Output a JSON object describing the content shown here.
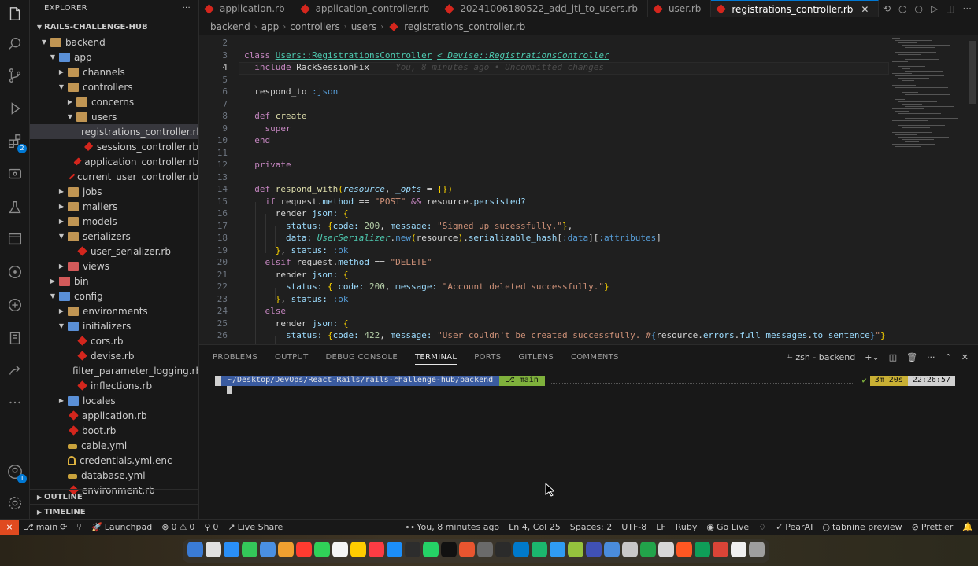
{
  "explorer": {
    "title": "EXPLORER",
    "more": "···",
    "root": "RAILS-CHALLENGE-HUB",
    "tree": [
      {
        "label": "backend",
        "depth": 0,
        "kind": "folder",
        "open": true
      },
      {
        "label": "app",
        "depth": 1,
        "kind": "folder-blue",
        "open": true
      },
      {
        "label": "channels",
        "depth": 2,
        "kind": "folder",
        "open": false
      },
      {
        "label": "controllers",
        "depth": 2,
        "kind": "folder",
        "open": true
      },
      {
        "label": "concerns",
        "depth": 3,
        "kind": "folder",
        "open": false
      },
      {
        "label": "users",
        "depth": 3,
        "kind": "folder",
        "open": true
      },
      {
        "label": "registrations_controller.rb",
        "depth": 4,
        "kind": "ruby",
        "selected": true
      },
      {
        "label": "sessions_controller.rb",
        "depth": 4,
        "kind": "ruby"
      },
      {
        "label": "application_controller.rb",
        "depth": 3,
        "kind": "ruby"
      },
      {
        "label": "current_user_controller.rb",
        "depth": 3,
        "kind": "ruby"
      },
      {
        "label": "jobs",
        "depth": 2,
        "kind": "folder",
        "open": false
      },
      {
        "label": "mailers",
        "depth": 2,
        "kind": "folder",
        "open": false
      },
      {
        "label": "models",
        "depth": 2,
        "kind": "folder",
        "open": false
      },
      {
        "label": "serializers",
        "depth": 2,
        "kind": "folder",
        "open": true
      },
      {
        "label": "user_serializer.rb",
        "depth": 3,
        "kind": "ruby"
      },
      {
        "label": "views",
        "depth": 2,
        "kind": "folder-red",
        "open": false
      },
      {
        "label": "bin",
        "depth": 1,
        "kind": "folder-red",
        "open": false
      },
      {
        "label": "config",
        "depth": 1,
        "kind": "folder-blue",
        "open": true
      },
      {
        "label": "environments",
        "depth": 2,
        "kind": "folder",
        "open": false
      },
      {
        "label": "initializers",
        "depth": 2,
        "kind": "folder-blue",
        "open": true
      },
      {
        "label": "cors.rb",
        "depth": 3,
        "kind": "ruby"
      },
      {
        "label": "devise.rb",
        "depth": 3,
        "kind": "ruby"
      },
      {
        "label": "filter_parameter_logging.rb",
        "depth": 3,
        "kind": "ruby"
      },
      {
        "label": "inflections.rb",
        "depth": 3,
        "kind": "ruby"
      },
      {
        "label": "locales",
        "depth": 2,
        "kind": "folder-blue",
        "open": false
      },
      {
        "label": "application.rb",
        "depth": 2,
        "kind": "ruby"
      },
      {
        "label": "boot.rb",
        "depth": 2,
        "kind": "ruby"
      },
      {
        "label": "cable.yml",
        "depth": 2,
        "kind": "yml"
      },
      {
        "label": "credentials.yml.enc",
        "depth": 2,
        "kind": "key"
      },
      {
        "label": "database.yml",
        "depth": 2,
        "kind": "yml"
      },
      {
        "label": "environment.rb",
        "depth": 2,
        "kind": "ruby"
      }
    ],
    "outline": "OUTLINE",
    "timeline": "TIMELINE"
  },
  "activity": {
    "extensions_badge": "2",
    "accounts_badge": "1"
  },
  "tabs": [
    {
      "label": "application.rb",
      "active": false
    },
    {
      "label": "application_controller.rb",
      "active": false
    },
    {
      "label": "20241006180522_add_jti_to_users.rb",
      "active": false
    },
    {
      "label": "user.rb",
      "active": false
    },
    {
      "label": "registrations_controller.rb",
      "active": true
    }
  ],
  "tab_close": "✕",
  "breadcrumb": [
    "backend",
    "app",
    "controllers",
    "users",
    "registrations_controller.rb"
  ],
  "editor": {
    "line_numbers": [
      "2",
      "3",
      "4",
      "5",
      "6",
      "7",
      "8",
      "9",
      "10",
      "11",
      "12",
      "13",
      "14",
      "15",
      "16",
      "17",
      "18",
      "19",
      "20",
      "21",
      "22",
      "23",
      "24",
      "25",
      "26"
    ],
    "current_line": "4",
    "blame": "You, 8 minutes ago • Uncommitted changes"
  },
  "panel": {
    "tabs": [
      "PROBLEMS",
      "OUTPUT",
      "DEBUG CONSOLE",
      "TERMINAL",
      "PORTS",
      "GITLENS",
      "COMMENTS"
    ],
    "active_tab": "TERMINAL",
    "terminal_name": "zsh - backend",
    "prompt_path": "~/Desktop/DevOps/React-Rails/rails-challenge-hub/backend",
    "prompt_branch": "main",
    "prompt_check": "✔",
    "prompt_duration": "3m 20s",
    "prompt_time": "22:26:57"
  },
  "statusbar": {
    "branch": "main",
    "launchpad": "Launchpad",
    "errors": "0",
    "warnings": "0",
    "ports": "0",
    "live_share": "Live Share",
    "blame": "You, 8 minutes ago",
    "position": "Ln 4, Col 25",
    "spaces": "Spaces: 2",
    "encoding": "UTF-8",
    "eol": "LF",
    "language": "Ruby",
    "go_live": "Go Live",
    "pearai": "PearAI",
    "tabnine": "tabnine preview",
    "prettier": "Prettier"
  },
  "colors": {
    "accent": "#0078d4",
    "remote": "#e04a1f",
    "ruby": "#d4261d"
  }
}
